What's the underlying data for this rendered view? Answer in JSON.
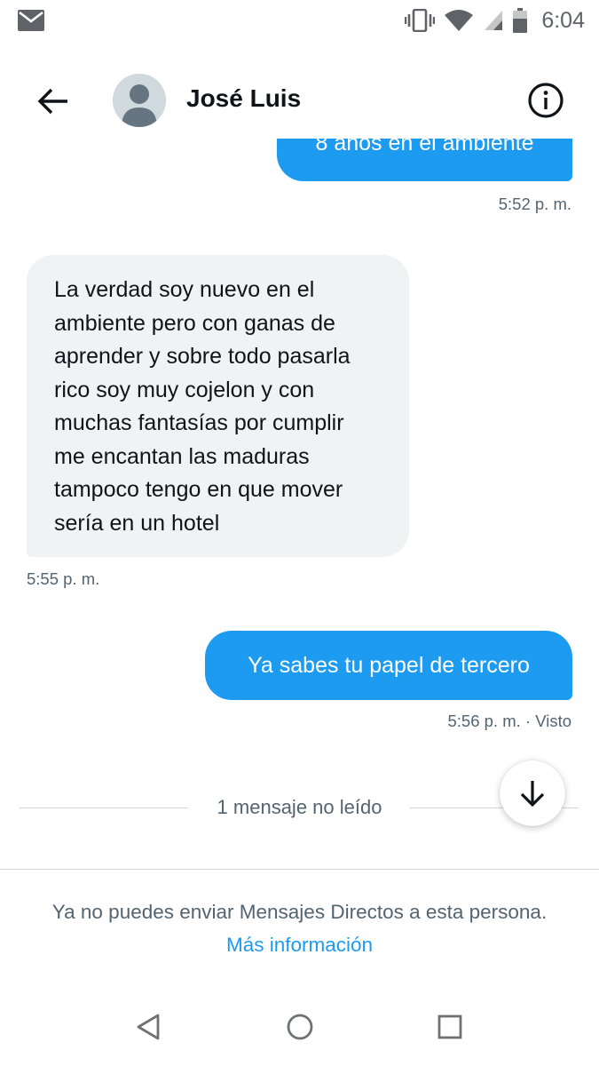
{
  "status_bar": {
    "time": "6:04",
    "icons": [
      "mail-icon",
      "vibrate-icon",
      "wifi-icon",
      "signal-icon",
      "battery-icon"
    ]
  },
  "header": {
    "contact_name": "José Luis",
    "icons": [
      "back-arrow-icon",
      "avatar-placeholder",
      "info-icon"
    ]
  },
  "messages": [
    {
      "direction": "outgoing",
      "text": "8 años en el ambiente",
      "timestamp": "5:52 p. m."
    },
    {
      "direction": "incoming",
      "lines": [
        "La verdad soy nuevo en el",
        "ambiente pero con ganas de",
        "aprender y sobre todo pasarla",
        "rico soy muy cojelon y con",
        "muchas fantasías por cumplir",
        "me encantan las maduras",
        "tampoco tengo en que mover",
        "sería en un hotel"
      ],
      "timestamp": "5:55 p. m."
    },
    {
      "direction": "outgoing",
      "text": "Ya sabes tu papel de tercero",
      "timestamp": "5:56 p. m. · Visto"
    }
  ],
  "unread_divider": {
    "label": "1 mensaje no leído"
  },
  "notice": {
    "text": "Ya no puedes enviar Mensajes Directos a esta persona.",
    "link": "Más información"
  },
  "colors": {
    "accent": "#1d9bf0",
    "incoming_bubble": "#eff3f4",
    "secondary_text": "#536471",
    "primary_text": "#0f1419"
  }
}
